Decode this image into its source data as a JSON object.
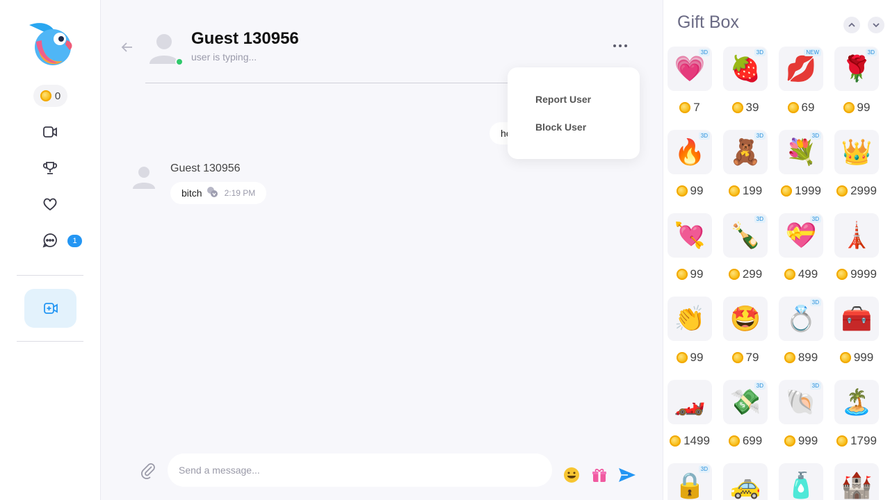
{
  "nav": {
    "coin_count": "0",
    "unread_badge": "1",
    "items": [
      {
        "icon": "video-camera-icon"
      },
      {
        "icon": "trophy-icon"
      },
      {
        "icon": "heart-icon"
      },
      {
        "icon": "chat-bubble-icon"
      }
    ]
  },
  "chat": {
    "title": "Guest 130956",
    "status": "user is typing...",
    "outgoing_preview": "he",
    "messages": [
      {
        "sender": "Guest 130956",
        "text": "bitch",
        "time": "2:19 PM"
      }
    ],
    "menu": [
      "Report User",
      "Block User"
    ],
    "input_placeholder": "Send a message...",
    "accent_color": "#2496f3",
    "online_color": "#2fc96b"
  },
  "gift_box": {
    "title": "Gift Box",
    "items": [
      {
        "name": "follow-me-heart",
        "tag": "3D",
        "price": "7",
        "emoji": "💗"
      },
      {
        "name": "chocolate-strawberry",
        "tag": "3D",
        "price": "39",
        "emoji": "🍓"
      },
      {
        "name": "lips",
        "tag": "NEW",
        "price": "69",
        "emoji": "💋"
      },
      {
        "name": "rose",
        "tag": "3D",
        "price": "99",
        "emoji": "🌹"
      },
      {
        "name": "fire",
        "tag": "3D",
        "price": "99",
        "emoji": "🔥"
      },
      {
        "name": "teddy-bear",
        "tag": "3D",
        "price": "199",
        "emoji": "🧸"
      },
      {
        "name": "rose-bouquet",
        "tag": "3D",
        "price": "1999",
        "emoji": "💐"
      },
      {
        "name": "tiara",
        "tag": "",
        "price": "2999",
        "emoji": "👑"
      },
      {
        "name": "heart-arrow",
        "tag": "",
        "price": "99",
        "emoji": "💘"
      },
      {
        "name": "champagne",
        "tag": "3D",
        "price": "299",
        "emoji": "🍾"
      },
      {
        "name": "heart-gift-box",
        "tag": "3D",
        "price": "499",
        "emoji": "💝"
      },
      {
        "name": "eiffel-tower",
        "tag": "",
        "price": "9999",
        "emoji": "🗼"
      },
      {
        "name": "clapping-hands",
        "tag": "",
        "price": "99",
        "emoji": "👏"
      },
      {
        "name": "star-struck",
        "tag": "",
        "price": "79",
        "emoji": "🤩"
      },
      {
        "name": "diamond-ring",
        "tag": "3D",
        "price": "899",
        "emoji": "💍"
      },
      {
        "name": "treasure-chest",
        "tag": "",
        "price": "999",
        "emoji": "🧰"
      },
      {
        "name": "sports-car",
        "tag": "",
        "price": "1499",
        "emoji": "🏎️"
      },
      {
        "name": "money-stack",
        "tag": "3D",
        "price": "699",
        "emoji": "💸"
      },
      {
        "name": "pearl-shell",
        "tag": "3D",
        "price": "999",
        "emoji": "🐚"
      },
      {
        "name": "palm-beach",
        "tag": "",
        "price": "1799",
        "emoji": "🏝️"
      },
      {
        "name": "heart-lock",
        "tag": "3D",
        "price": "",
        "emoji": "🔒"
      },
      {
        "name": "yellow-car",
        "tag": "",
        "price": "",
        "emoji": "🚕"
      },
      {
        "name": "perfume",
        "tag": "",
        "price": "",
        "emoji": "🧴"
      },
      {
        "name": "castle",
        "tag": "",
        "price": "",
        "emoji": "🏰"
      }
    ]
  }
}
